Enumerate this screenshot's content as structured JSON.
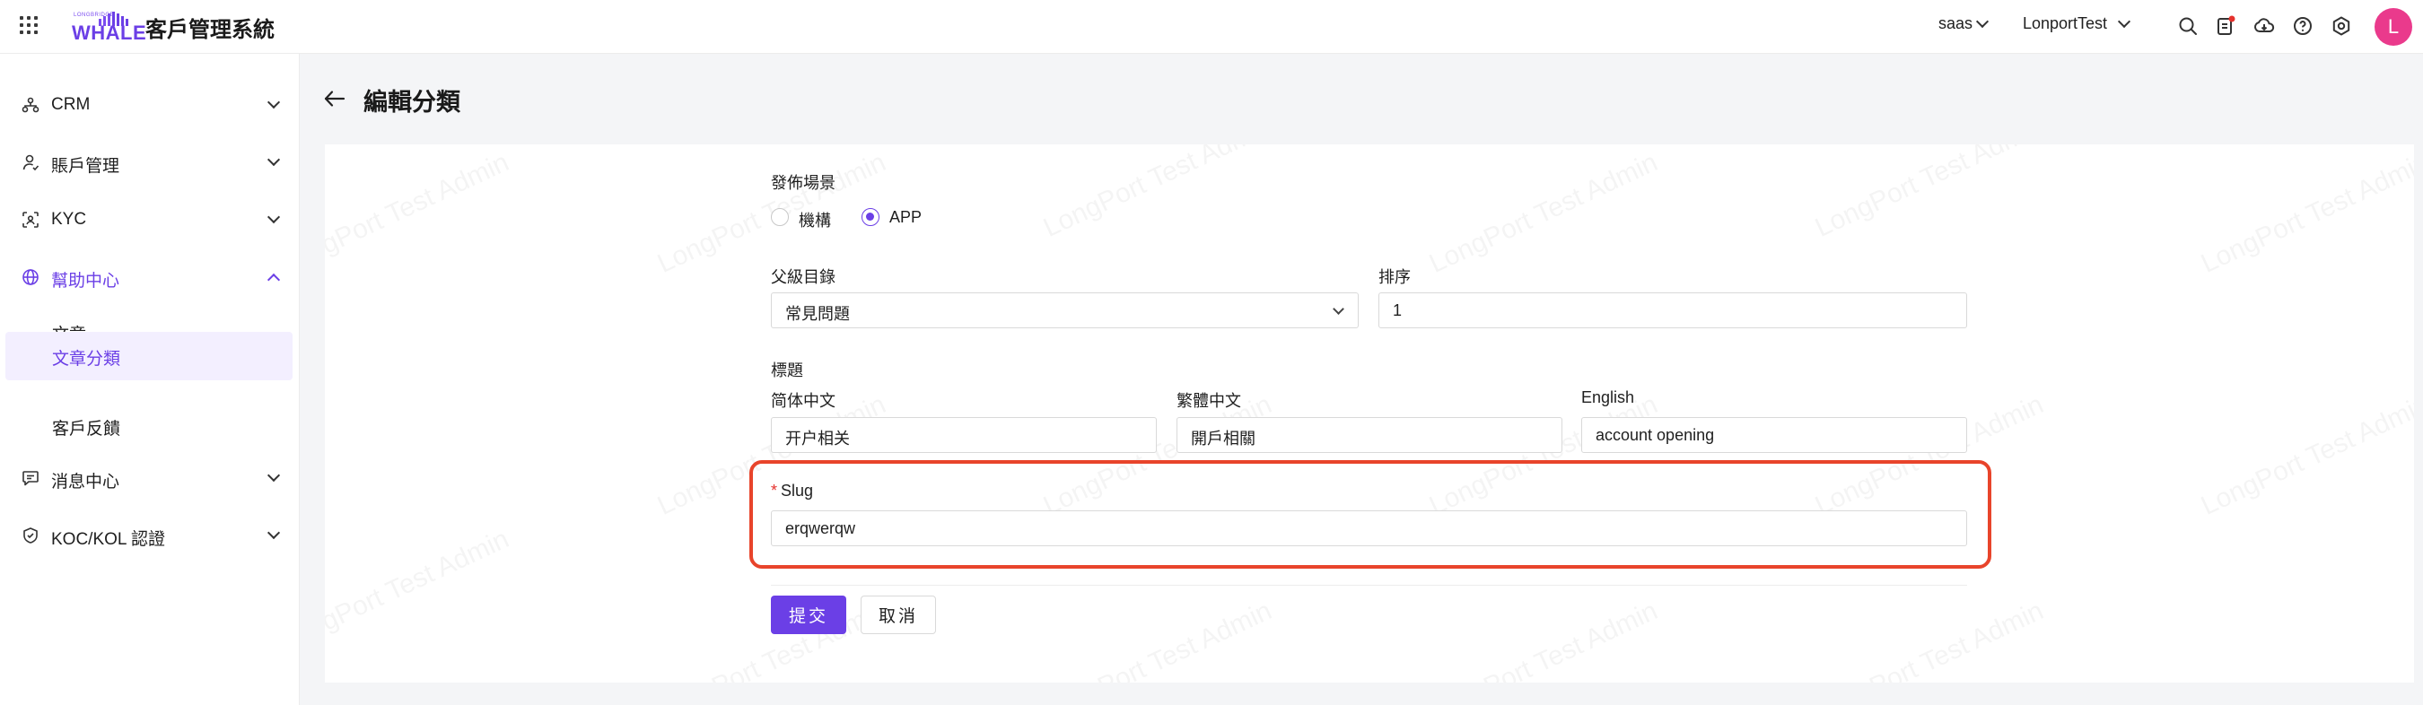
{
  "app": {
    "logo_small": "LONGBRIDGE",
    "logo_word": "WHALE",
    "title": "客戶管理系統"
  },
  "header": {
    "tenant": "saas",
    "org": "LonportTest",
    "avatar_initial": "L",
    "icons": [
      "search-icon",
      "notification-doc-icon",
      "cloud-download-icon",
      "help-icon",
      "settings-icon"
    ],
    "notification_dot_color": "#e5322d"
  },
  "sidebar": {
    "items": [
      {
        "label": "CRM",
        "icon": "crm-network-icon"
      },
      {
        "label": "賬戶管理",
        "icon": "user-icon"
      },
      {
        "label": "KYC",
        "icon": "face-scan-icon"
      },
      {
        "label": "幫助中心",
        "icon": "globe-icon",
        "expanded": true
      },
      {
        "label": "消息中心",
        "icon": "message-icon"
      },
      {
        "label": "KOC/KOL 認證",
        "icon": "shield-icon"
      }
    ],
    "help_sub_items": [
      {
        "label": "文章"
      },
      {
        "label": "文章分類",
        "selected": true
      },
      {
        "label": "客戶反饋"
      }
    ]
  },
  "page": {
    "title": "編輯分類",
    "watermark": "LongPort Test Admin"
  },
  "form": {
    "scene_label": "發佈場景",
    "scene_options": [
      "機構",
      "APP"
    ],
    "scene_selected": "APP",
    "parent_label": "父級目錄",
    "parent_value": "常見問題",
    "sort_label": "排序",
    "sort_value": "1",
    "title_label": "標題",
    "title_sc_label": "简体中文",
    "title_sc_value": "开户相关",
    "title_tc_label": "繁體中文",
    "title_tc_value": "開戶相關",
    "title_en_label": "English",
    "title_en_value": "account opening",
    "slug_required": "*",
    "slug_label": "Slug",
    "slug_value": "erqwerqw",
    "submit_label": "提交",
    "cancel_label": "取消"
  },
  "colors": {
    "accent": "#6b3fe6",
    "highlight": "#e8442b",
    "avatar": "#ea3a8c"
  }
}
